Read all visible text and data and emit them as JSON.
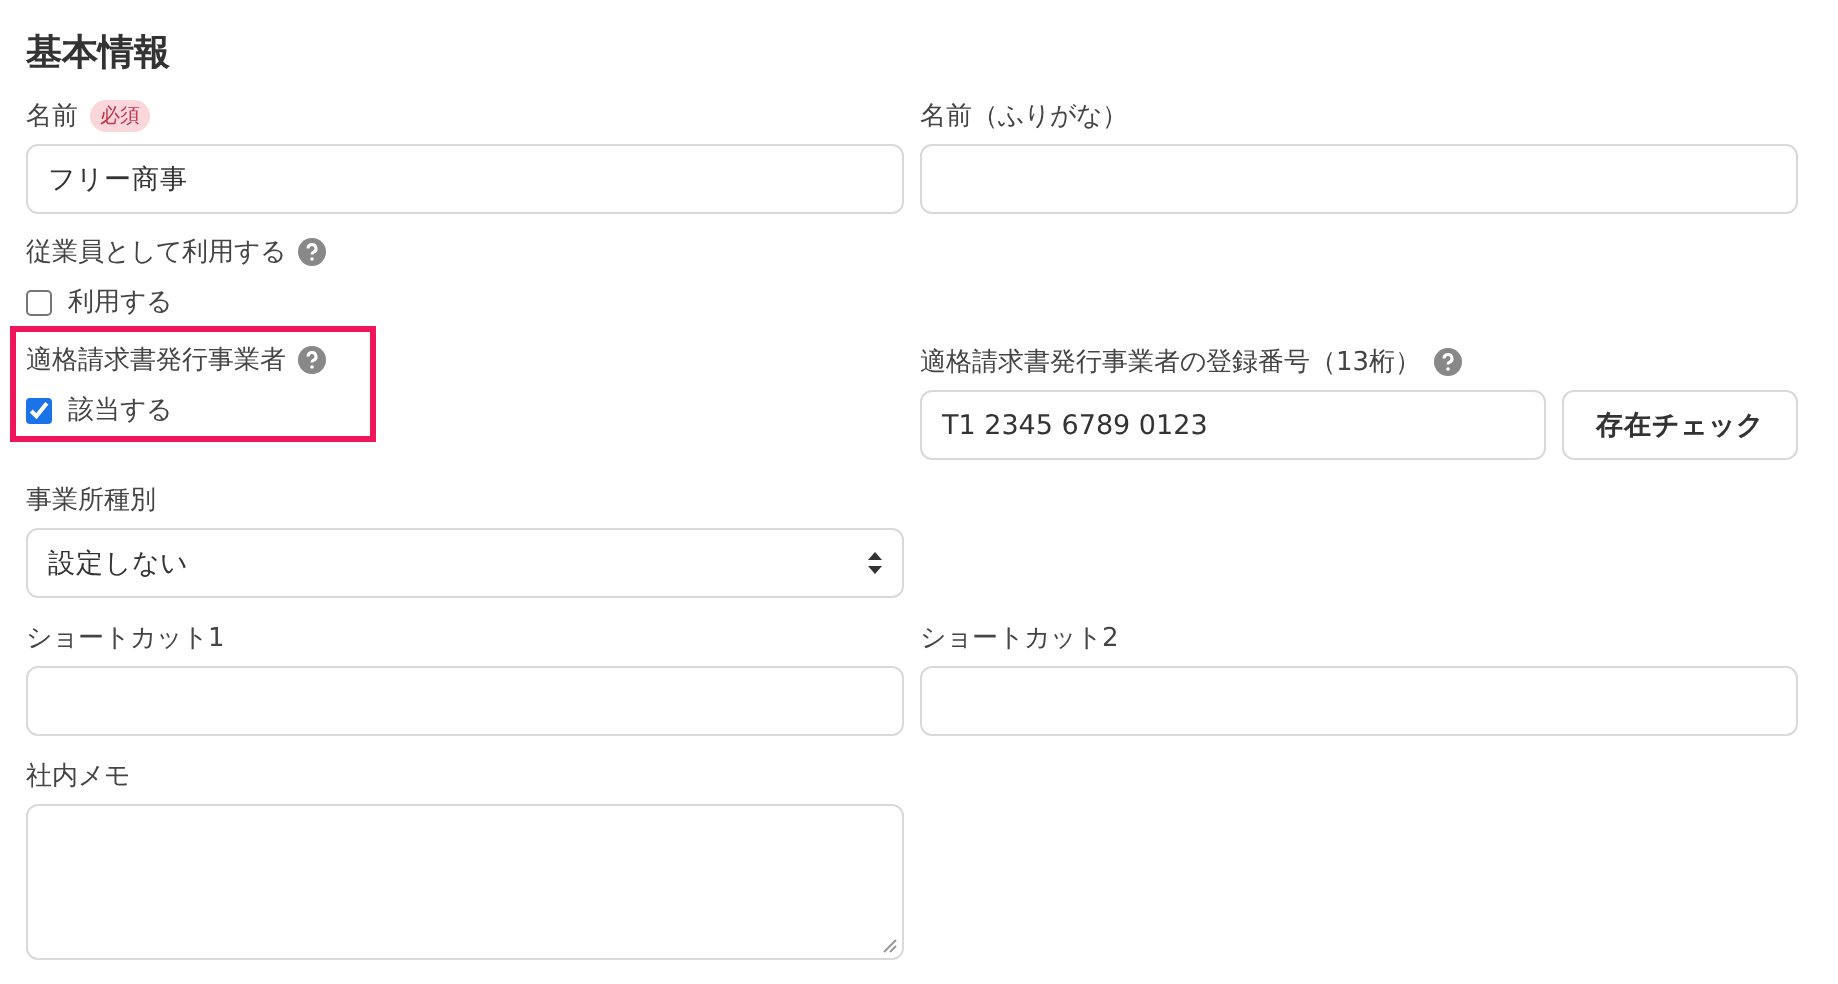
{
  "title": "基本情報",
  "rows": [
    [
      {
        "kind": "text",
        "label": "名前",
        "required_badge": "必須",
        "value": "フリー商事"
      },
      {
        "kind": "text",
        "label": "名前（ふりがな）"
      }
    ],
    [
      {
        "kind": "checkbox",
        "label": "従業員として利用する",
        "help": true,
        "option": "利用する",
        "checked": false
      }
    ],
    [
      {
        "kind": "checkbox",
        "label": "適格請求書発行事業者",
        "help": true,
        "option": "該当する",
        "checked": true,
        "highlighted": true
      },
      {
        "kind": "text_with_button",
        "label": "適格請求書発行事業者の登録番号（13桁）",
        "help": true,
        "value": "T1 2345 6789 0123",
        "button": "存在チェック"
      }
    ],
    [
      {
        "kind": "select",
        "label": "事業所種別",
        "value": "設定しない"
      }
    ],
    [
      {
        "kind": "text",
        "label": "ショートカット1"
      },
      {
        "kind": "text",
        "label": "ショートカット2"
      }
    ],
    [
      {
        "kind": "textarea",
        "label": "社内メモ"
      }
    ]
  ]
}
